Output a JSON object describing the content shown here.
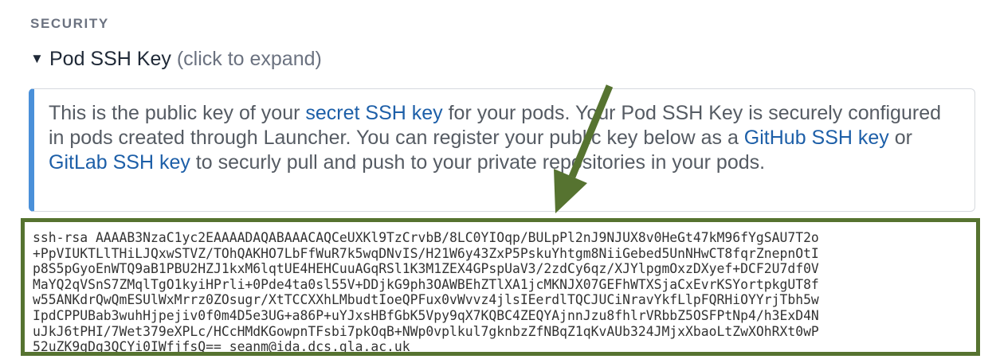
{
  "section": {
    "title": "SECURITY"
  },
  "ssh": {
    "summary_label": "Pod SSH Key",
    "summary_hint": "(click to expand)",
    "info": {
      "t1": "This is the public key of your ",
      "link_secret": "secret SSH key",
      "t2": " for your pods. Your Pod SSH Key is securely configured in pods created through Launcher. You can register your public key below as a ",
      "link_github": "GitHub SSH key",
      "t3": " or ",
      "link_gitlab": "GitLab SSH key",
      "t4": " to securly pull and push to your private repositories in your pods."
    },
    "public_key_lines": [
      "ssh-rsa AAAAB3NzaC1yc2EAAAADAQABAAACAQCeUXKl9TzCrvbB/8LC0YIOqp/BULpPl2nJ9NJUX8v0HeGt47kM96fYgSAU7T2o",
      "+PpVIUKTLlTHiLJQxwSTVZ/TOhQAKHO7LbFfWuR7k5wqDNvIS/H21W6y43ZxP5PskuYhtgm8NiiGebed5UnNHwCT8fqrZnepnOtI",
      "p8S5pGyoEnWTQ9aB1PBU2HZJ1kxM6lqtUE4HEHCuuAGqRSl1K3M1ZEX4GPspUaV3/2zdCy6qz/XJYlpgmOxzDXyef+DCF2U7df0V",
      "MaYQ2qVSnS7ZMqlTgO1kyiHPrli+0Pde4ta0sl55V+DDjkG9ph3OAWBEhZTlXA1jcMKNJX07GEFhWTXSjaCxEvrKSYortpkgUT8f",
      "w55ANKdrQwQmESUlWxMrrz0ZOsugr/XtTCCXXhLMbudtIoeQPFux0vWvvz4jlsIEerdlTQCJUCiNravYkfLlpFQRHiOYYrjTbh5w",
      "IpdCPPUBab3wuhHjpejiv0f0m4D5e3UG+a86P+uYJxsHBfGbK5Vpy9qX7KQBC4ZEQYAjnnJzu8fhlrVRbbZ5OSFPtNp4/h3ExD4N",
      "uJkJ6tPHI/7Wet379eXPLc/HCcHMdKGowpnTFsbi7pkOqB+NWp0vplkul7gknbzZfNBqZ1qKvAUb324JMjxXbaoLtZwXOhRXt0wP",
      "52uZK9gDg3QCYi0IWfjfsQ== seanm@ida.dcs.gla.ac.uk"
    ]
  },
  "colors": {
    "link": "#1d5fa8",
    "info_accent": "#4a90d9",
    "highlight": "#567330"
  },
  "icons": {
    "expand": "triangle-down-icon",
    "annotation": "arrow-annotation-icon"
  }
}
